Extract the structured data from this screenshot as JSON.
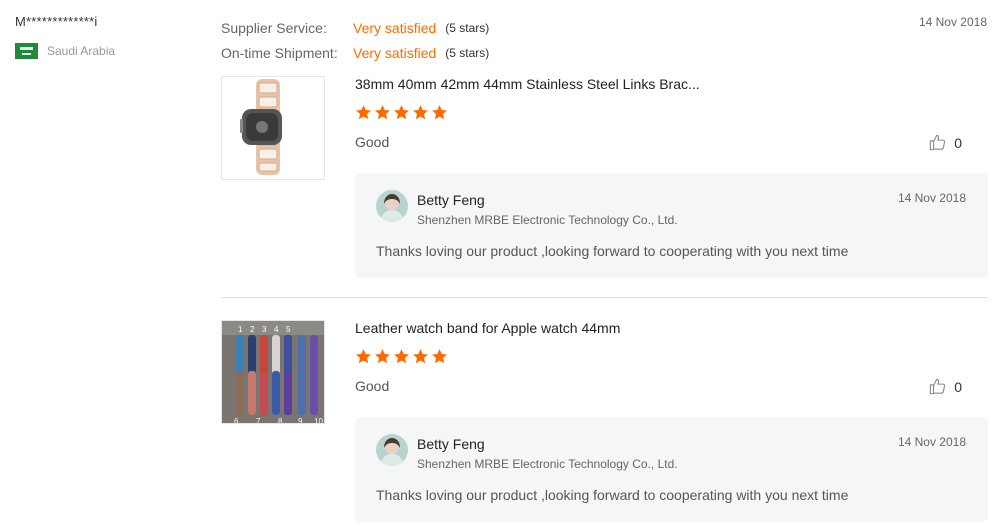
{
  "reviewer": {
    "name": "M*************i",
    "country": "Saudi Arabia",
    "flag_icon": "saudi-arabia-flag-icon"
  },
  "ratings": {
    "supplier_service": {
      "label": "Supplier Service:",
      "value": "Very satisfied",
      "stars": "(5 stars)"
    },
    "shipment": {
      "label": "On-time Shipment:",
      "value": "Very satisfied",
      "stars": "(5 stars)"
    }
  },
  "date": "14 Nov 2018",
  "colors": {
    "accent": "#ff6a00",
    "reply_bg": "#f5f6f8"
  },
  "items": [
    {
      "title": "38mm 40mm 42mm 44mm Stainless Steel Links Brac...",
      "rating": 5,
      "comment": "Good",
      "likes": "0",
      "reply": {
        "name": "Betty Feng",
        "company": "Shenzhen MRBE Electronic Technology Co., Ltd.",
        "date": "14 Nov 2018",
        "text": "Thanks loving our product ,looking forward to cooperating with you next time"
      }
    },
    {
      "title": "Leather watch band for Apple watch 44mm",
      "rating": 5,
      "comment": "Good",
      "likes": "0",
      "reply": {
        "name": "Betty Feng",
        "company": "Shenzhen MRBE Electronic Technology Co., Ltd.",
        "date": "14 Nov 2018",
        "text": "Thanks loving our product ,looking forward to cooperating with you next time"
      }
    }
  ],
  "thumb2_numbers_top": [
    "1",
    "2",
    "3",
    "4",
    "5"
  ],
  "thumb2_numbers_bottom": [
    "6",
    "7",
    "8",
    "9",
    "10"
  ]
}
